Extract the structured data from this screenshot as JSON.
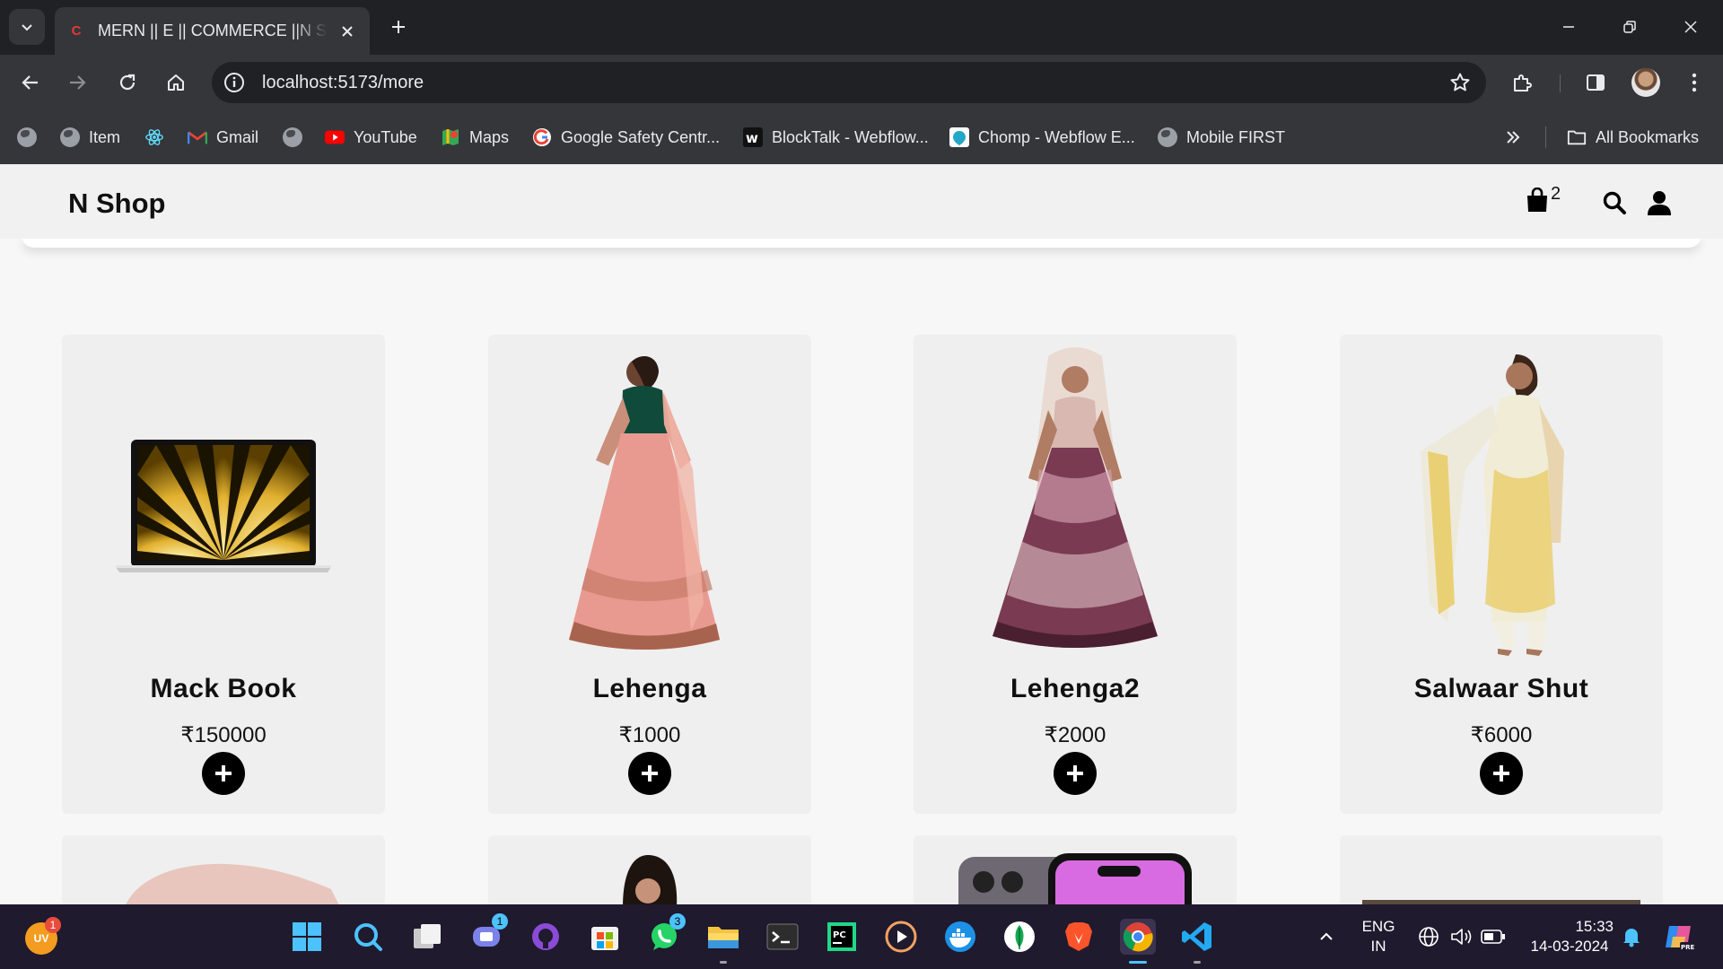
{
  "browser": {
    "tab": {
      "title": "MERN || E || COMMERCE ||N SHOP",
      "favicon": "C"
    },
    "url": "localhost:5173/more",
    "bookmarks": [
      {
        "label": "",
        "icon": "globe-icon"
      },
      {
        "label": "Item",
        "icon": "globe-icon"
      },
      {
        "label": "",
        "icon": "react-icon"
      },
      {
        "label": "Gmail",
        "icon": "gmail-icon"
      },
      {
        "label": "",
        "icon": "globe-icon"
      },
      {
        "label": "YouTube",
        "icon": "youtube-icon"
      },
      {
        "label": "Maps",
        "icon": "maps-icon"
      },
      {
        "label": "Google Safety Centr...",
        "icon": "google-icon"
      },
      {
        "label": "BlockTalk - Webflow...",
        "icon": "webflow-icon"
      },
      {
        "label": "Chomp - Webflow E...",
        "icon": "chomp-icon"
      },
      {
        "label": "Mobile FIRST",
        "icon": "globe-icon"
      }
    ],
    "all_bookmarks_label": "All Bookmarks"
  },
  "site": {
    "logo": "N Shop",
    "cart_count": "2"
  },
  "products": [
    {
      "name": "Mack Book",
      "price": "₹150000",
      "image": "laptop"
    },
    {
      "name": "Lehenga",
      "price": "₹1000",
      "image": "lehenga-pink"
    },
    {
      "name": "Lehenga2",
      "price": "₹2000",
      "image": "lehenga-maroon"
    },
    {
      "name": "Salwaar Shut",
      "price": "₹6000",
      "image": "salwaar-yellow"
    }
  ],
  "taskbar": {
    "user_initials": "UV",
    "user_badge": "1",
    "teams_badge": "1",
    "whatsapp_badge": "3",
    "language": "ENG",
    "region": "IN",
    "time": "15:33",
    "date": "14-03-2024"
  },
  "colors": {
    "chrome_dark": "#202124",
    "chrome_mid": "#35363a",
    "card_bg": "#efefef",
    "page_bg": "#f7f7f7",
    "taskbar_bg": "#1f1a2e"
  }
}
